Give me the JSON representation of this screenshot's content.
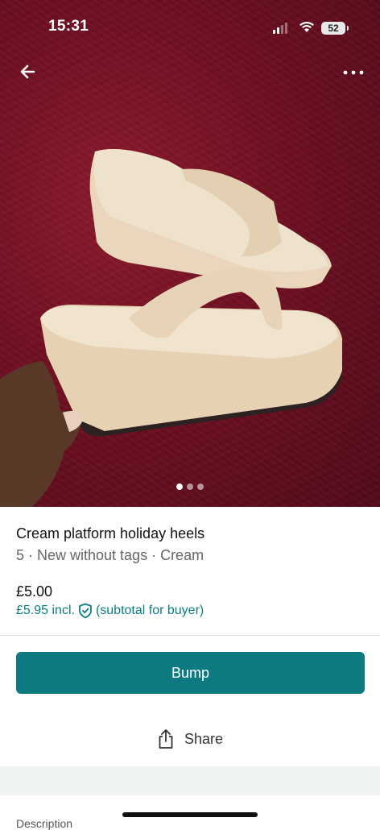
{
  "status_bar": {
    "time": "15:31",
    "battery": "52"
  },
  "carousel": {
    "total_images": 3,
    "active_index": 0
  },
  "item": {
    "title": "Cream platform holiday heels",
    "details": "5 · New without tags · Cream",
    "price": "£5.00",
    "price_incl": "£5.95 incl.",
    "buyer_note": "(subtotal for buyer)"
  },
  "actions": {
    "bump_label": "Bump",
    "share_label": "Share"
  },
  "section": {
    "description_label": "Description"
  },
  "colors": {
    "accent": "#0c7a80",
    "link": "#0a7d83",
    "photo_background": "#6e0f22"
  },
  "icons": [
    "back-arrow-icon",
    "more-options-icon",
    "shield-check-icon",
    "share-icon"
  ]
}
